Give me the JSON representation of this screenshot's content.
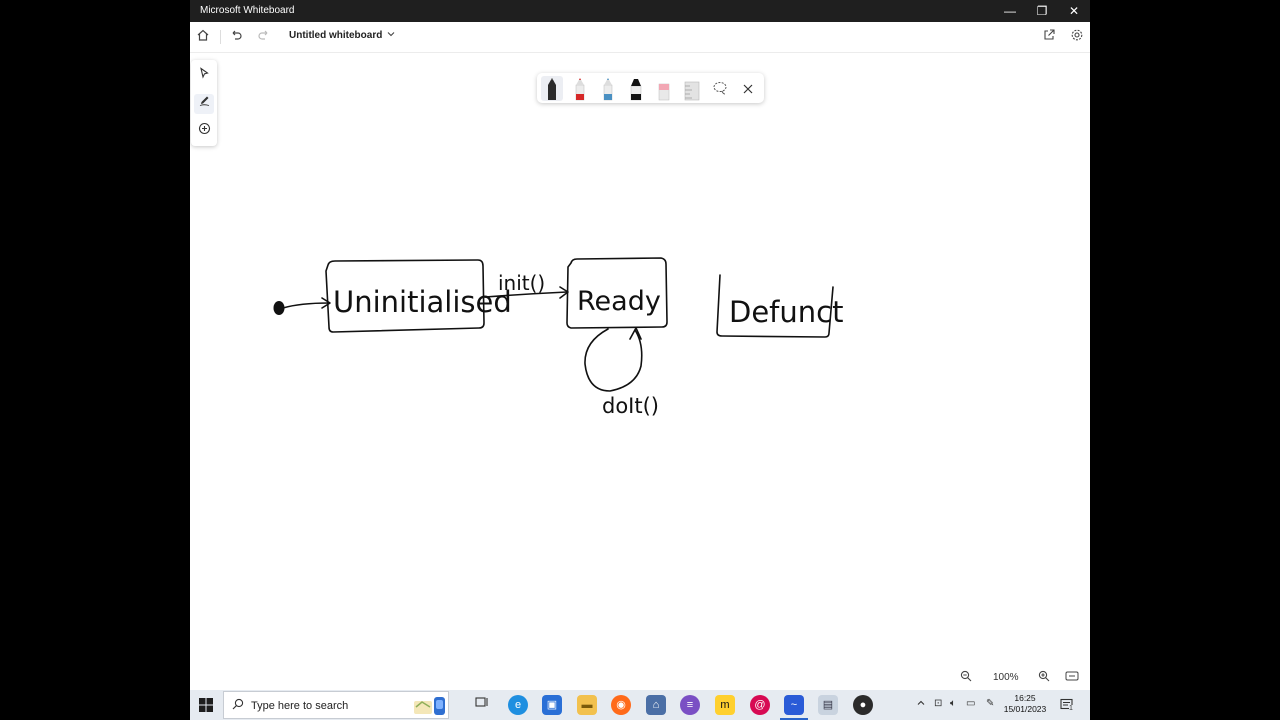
{
  "window": {
    "title": "Microsoft Whiteboard",
    "minimize": "—",
    "restore": "❐",
    "close": "✕"
  },
  "commandbar": {
    "document_title": "Untitled whiteboard",
    "home_icon": "home-icon",
    "undo_icon": "undo-icon",
    "redo_icon": "redo-icon",
    "share_icon": "share-icon",
    "settings_icon": "gear-icon"
  },
  "left_toolbar": {
    "tools": [
      "select-tool",
      "inking-tool",
      "add-content-tool"
    ],
    "active": "inking-tool"
  },
  "pen_tray": {
    "pens": [
      {
        "name": "black-pen",
        "color": "#222222",
        "selected": true
      },
      {
        "name": "red-pen",
        "color": "#d62828"
      },
      {
        "name": "blue-pen",
        "color": "#4a90c2"
      },
      {
        "name": "black-marker",
        "color": "#111111"
      },
      {
        "name": "eraser",
        "color": "#f2a7b4"
      },
      {
        "name": "ruler",
        "color": "#bdbdbd"
      }
    ],
    "lasso_icon": "lasso-icon",
    "close_icon": "close-icon"
  },
  "diagram": {
    "states": [
      "Uninitialised",
      "Ready",
      "Defunct"
    ],
    "transitions": [
      "init()",
      "doIt()"
    ]
  },
  "zoom": {
    "level": "100%"
  },
  "taskbar": {
    "search_placeholder": "Type here to search",
    "apps": [
      "task-view",
      "edge",
      "store",
      "file-explorer",
      "firefox",
      "connect",
      "eclipse",
      "miro",
      "debian",
      "whiteboard",
      "photos",
      "obs"
    ],
    "time": "16:25",
    "date": "15/01/2023",
    "notification_count": "1"
  }
}
